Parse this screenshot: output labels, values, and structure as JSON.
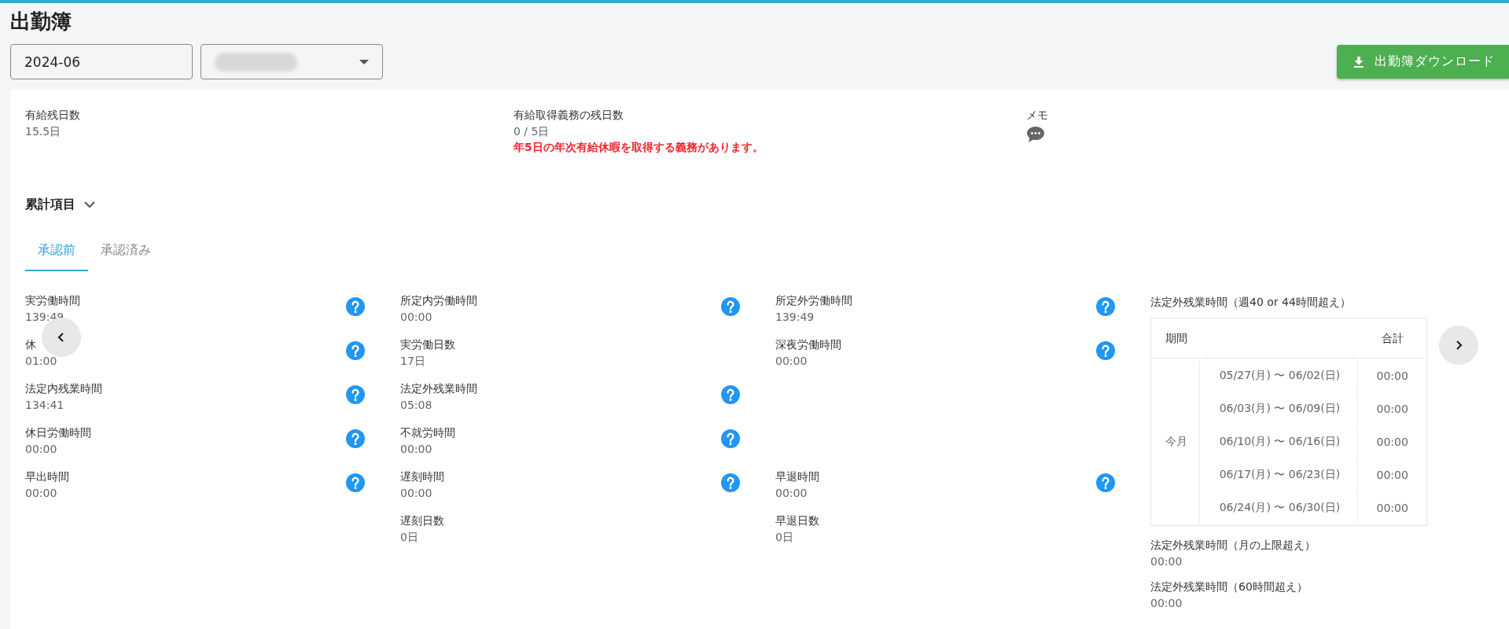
{
  "title": "出勤簿",
  "month_field": {
    "value": "2024-06"
  },
  "download_button": {
    "label": "出勤簿ダウンロード"
  },
  "summary": [
    {
      "kind": "plain",
      "label": "有給残日数",
      "value": "15.5日"
    },
    {
      "kind": "warning",
      "label": "有給取得義務の残日数",
      "value": "0 / 5日",
      "warning": "年5日の年次有給休暇を取得する義務があります。"
    },
    {
      "kind": "memo",
      "label": "メモ"
    }
  ],
  "section": {
    "title": "累計項目",
    "expanded": true
  },
  "tabs": [
    {
      "label": "承認前",
      "selected": true
    },
    {
      "label": "承認済み",
      "selected": false
    }
  ],
  "stat_rows": [
    [
      {
        "kind": "stat",
        "label": "実労働時間",
        "value": "139:49",
        "help": true
      },
      {
        "kind": "stat",
        "label": "所定内労働時間",
        "value": "00:00",
        "help": true
      },
      {
        "kind": "stat",
        "label": "所定外労働時間",
        "value": "139:49",
        "help": true
      }
    ],
    [
      {
        "kind": "stat",
        "label": "休",
        "value": "01:00",
        "help": true
      },
      {
        "kind": "stat",
        "label": "実労働日数",
        "value": "17日",
        "help": false
      },
      {
        "kind": "stat",
        "label": "深夜労働時間",
        "value": "00:00",
        "help": true
      }
    ],
    [
      {
        "kind": "stat",
        "label": "法定内残業時間",
        "value": "134:41",
        "help": true
      },
      {
        "kind": "stat",
        "label": "法定外残業時間",
        "value": "05:08",
        "help": true
      },
      {
        "kind": "gap"
      }
    ],
    [
      {
        "kind": "stat",
        "label": "休日労働時間",
        "value": "00:00",
        "help": true
      },
      {
        "kind": "stat",
        "label": "不就労時間",
        "value": "00:00",
        "help": true
      },
      {
        "kind": "gap"
      }
    ],
    [
      {
        "kind": "stat",
        "label": "早出時間",
        "value": "00:00",
        "help": true
      },
      {
        "kind": "stat",
        "label": "遅刻時間",
        "value": "00:00",
        "help": true
      },
      {
        "kind": "stat",
        "label": "早退時間",
        "value": "00:00",
        "help": true
      }
    ],
    [
      {
        "kind": "gap"
      },
      {
        "kind": "stat",
        "label": "遅刻日数",
        "value": "0日",
        "help": false
      },
      {
        "kind": "stat",
        "label": "早退日数",
        "value": "0日",
        "help": false
      }
    ]
  ],
  "overtime": {
    "title": "法定外残業時間（週40 or 44時間超え）",
    "table": {
      "period_header": "期間",
      "total_header": "合計",
      "group": "今月",
      "rows": [
        {
          "range": "05/27(月) 〜 06/02(日)",
          "total": "00:00"
        },
        {
          "range": "06/03(月) 〜 06/09(日)",
          "total": "00:00"
        },
        {
          "range": "06/10(月) 〜 06/16(日)",
          "total": "00:00"
        },
        {
          "range": "06/17(月) 〜 06/23(日)",
          "total": "00:00"
        },
        {
          "range": "06/24(月) 〜 06/30(日)",
          "total": "00:00"
        }
      ]
    },
    "extras": [
      {
        "label": "法定外残業時間（月の上限超え）",
        "value": "00:00"
      },
      {
        "label": "法定外残業時間（60時間超え）",
        "value": "00:00"
      }
    ]
  }
}
